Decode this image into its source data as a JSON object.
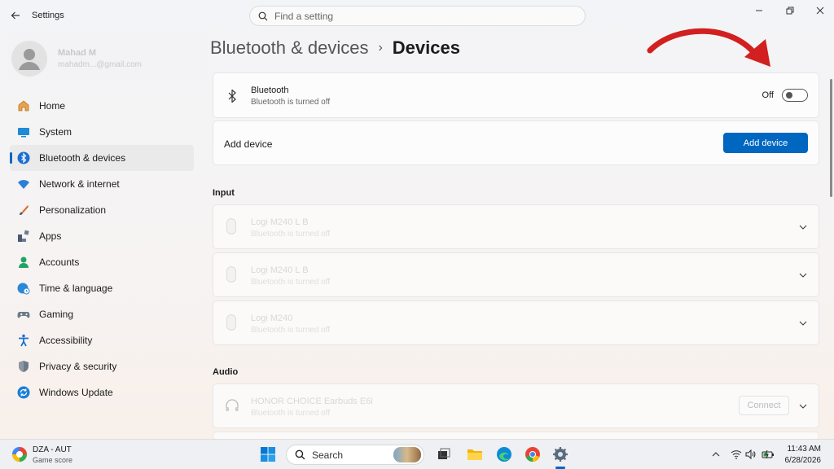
{
  "window": {
    "app_title": "Settings",
    "search_placeholder": "Find a setting"
  },
  "user": {
    "name": "Mahad M",
    "email": "mahadm...@gmail.com"
  },
  "sidebar": {
    "items": [
      {
        "label": "Home",
        "icon": "home-icon"
      },
      {
        "label": "System",
        "icon": "system-icon"
      },
      {
        "label": "Bluetooth & devices",
        "icon": "bluetooth-icon",
        "active": true
      },
      {
        "label": "Network & internet",
        "icon": "wifi-icon"
      },
      {
        "label": "Personalization",
        "icon": "brush-icon"
      },
      {
        "label": "Apps",
        "icon": "apps-icon"
      },
      {
        "label": "Accounts",
        "icon": "person-icon"
      },
      {
        "label": "Time & language",
        "icon": "globe-clock-icon"
      },
      {
        "label": "Gaming",
        "icon": "controller-icon"
      },
      {
        "label": "Accessibility",
        "icon": "accessibility-icon"
      },
      {
        "label": "Privacy & security",
        "icon": "shield-icon"
      },
      {
        "label": "Windows Update",
        "icon": "update-icon"
      }
    ]
  },
  "breadcrumb": {
    "parent": "Bluetooth & devices",
    "separator": "›",
    "current": "Devices"
  },
  "bluetooth": {
    "title": "Bluetooth",
    "status": "Bluetooth is turned off",
    "toggle_label": "Off",
    "enabled": false
  },
  "add_device": {
    "label": "Add device",
    "button": "Add device"
  },
  "sections": {
    "input": "Input",
    "audio": "Audio"
  },
  "input_devices": [
    {
      "name": "Logi M240 L B",
      "status": "Bluetooth is turned off"
    },
    {
      "name": "Logi M240 L B",
      "status": "Bluetooth is turned off"
    },
    {
      "name": "Logi M240",
      "status": "Bluetooth is turned off"
    }
  ],
  "audio_devices": [
    {
      "name": "HONOR CHOICE Earbuds E6i",
      "status": "Bluetooth is turned off",
      "button": "Connect"
    }
  ],
  "taskbar": {
    "weather_title": "DZA - AUT",
    "weather_sub": "Game score",
    "search_label": "Search",
    "time": "11:43 AM",
    "date": "6/28/2026"
  },
  "colors": {
    "accent": "#0067c0",
    "annotation_arrow": "#d21f1f"
  }
}
